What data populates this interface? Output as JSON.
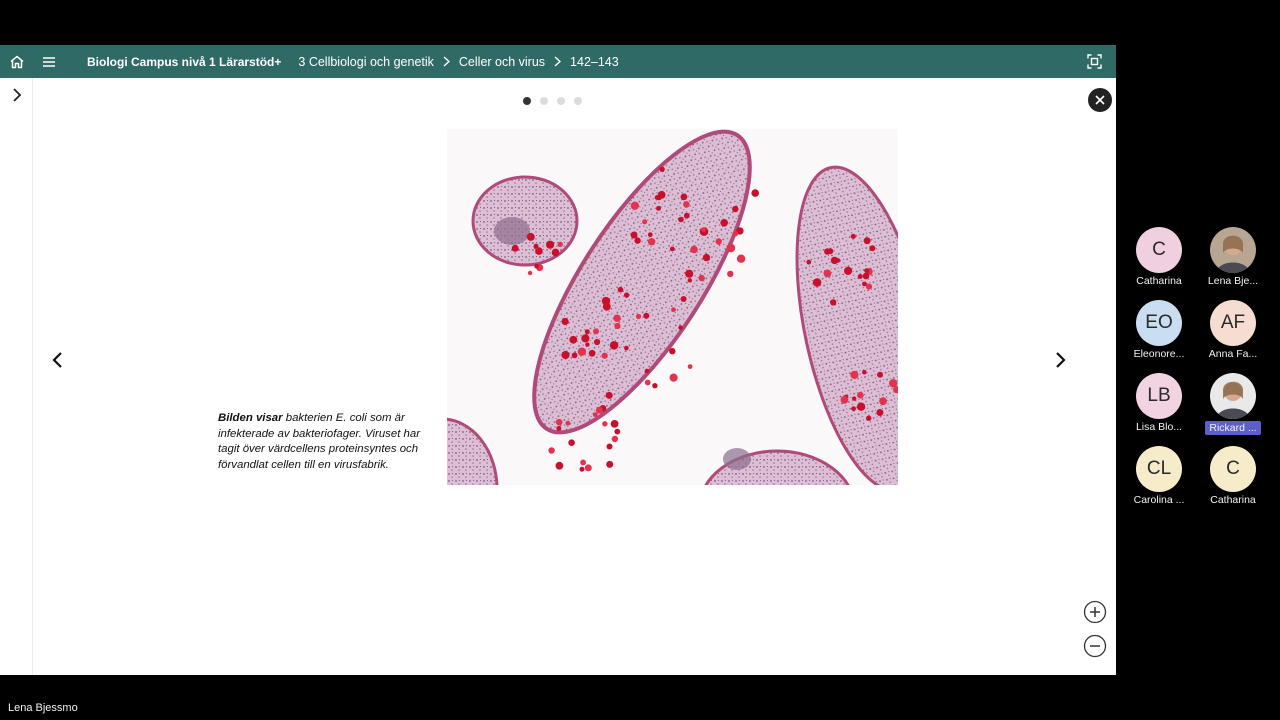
{
  "header": {
    "book_title": "Biologi Campus nivå 1 Lärarstöd+",
    "breadcrumbs": [
      "3 Cellbiologi och genetik",
      "Celler och virus",
      "142–143"
    ]
  },
  "viewer": {
    "slide_count": 4,
    "active_slide": 1,
    "caption_lead": "Bilden visar",
    "caption_rest": " bakterien E. coli som är infekterade av bakteriofager. Viruset har tagit över värdcellens proteinsyntes och förvandlat cellen till en virusfabrik."
  },
  "participants": [
    {
      "initials": "C",
      "name": "Catharina",
      "color": "#f0cfe0"
    },
    {
      "initials": "",
      "name": "Lena Bje...",
      "color": "#b9a692",
      "photo": true
    },
    {
      "initials": "EO",
      "name": "Eleonore...",
      "color": "#c9def0"
    },
    {
      "initials": "AF",
      "name": "Anna Fa...",
      "color": "#f6ddd2"
    },
    {
      "initials": "LB",
      "name": "Lisa Blo...",
      "color": "#f2d3e2"
    },
    {
      "initials": "",
      "name": "Rickard ...",
      "color": "#e9e9e9",
      "photo": true,
      "highlight": true
    },
    {
      "initials": "CL",
      "name": "Carolina ...",
      "color": "#f7ecc9"
    },
    {
      "initials": "C",
      "name": "Catharina",
      "color": "#f7ecc9"
    }
  ],
  "self_name": "Lena Bjessmo",
  "icons": [
    "home-icon",
    "menu-icon",
    "chevron-right-icon",
    "fit-screen-icon",
    "close-icon",
    "chevron-left-icon",
    "zoom-in-icon",
    "zoom-out-icon"
  ],
  "colors": {
    "header_bg": "#2f6a66",
    "accent": "#5b5fc7"
  }
}
